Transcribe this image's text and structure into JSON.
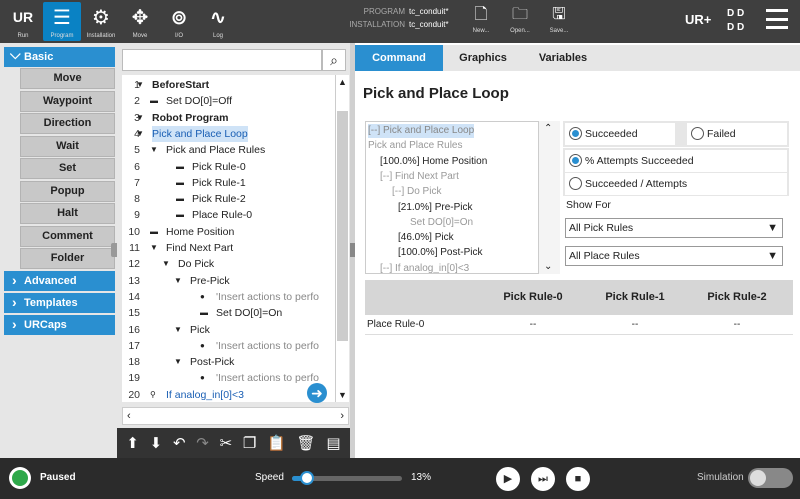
{
  "topnav": [
    {
      "label": "Run",
      "icon": "UR"
    },
    {
      "label": "Program",
      "icon": "☰"
    },
    {
      "label": "Installation",
      "icon": "⚙"
    },
    {
      "label": "Move",
      "icon": "✥"
    },
    {
      "label": "I/O",
      "icon": "⊚"
    },
    {
      "label": "Log",
      "icon": "∿"
    }
  ],
  "program": {
    "program_key": "PROGRAM",
    "program_value": "tc_conduit*",
    "installation_key": "INSTALLATION",
    "installation_value": "tc_conduit*"
  },
  "file": {
    "new": "New...",
    "open": "Open...",
    "save": "Save..."
  },
  "brand": {
    "ur_plus": "UR+",
    "dots": "D D\nD D"
  },
  "left": {
    "basic": "Basic",
    "basic_items": [
      "Move",
      "Waypoint",
      "Direction",
      "Wait",
      "Set",
      "Popup",
      "Halt",
      "Comment",
      "Folder"
    ],
    "advanced": "Advanced",
    "templates": "Templates",
    "urcaps": "URCaps"
  },
  "tree": [
    {
      "n": "1",
      "t": "BeforeStart",
      "bold": true
    },
    {
      "n": "2",
      "t": "Set DO[0]=Off"
    },
    {
      "n": "3",
      "t": "Robot Program",
      "bold": true
    },
    {
      "n": "4",
      "t": "Pick and Place Loop",
      "sel": true
    },
    {
      "n": "5",
      "t": "Pick and Place Rules"
    },
    {
      "n": "6",
      "t": "Pick Rule-0"
    },
    {
      "n": "7",
      "t": "Pick Rule-1"
    },
    {
      "n": "8",
      "t": "Pick Rule-2"
    },
    {
      "n": "9",
      "t": "Place Rule-0"
    },
    {
      "n": "10",
      "t": "Home Position"
    },
    {
      "n": "11",
      "t": "Find Next Part"
    },
    {
      "n": "12",
      "t": "Do Pick"
    },
    {
      "n": "13",
      "t": "Pre-Pick"
    },
    {
      "n": "14",
      "t": "'Insert actions to perfo"
    },
    {
      "n": "15",
      "t": "Set DO[0]=On"
    },
    {
      "n": "16",
      "t": "Pick"
    },
    {
      "n": "17",
      "t": "'Insert actions to perfo"
    },
    {
      "n": "18",
      "t": "Post-Pick"
    },
    {
      "n": "19",
      "t": "'Insert actions to perfo"
    },
    {
      "n": "20",
      "t": "If analog_in[0]<3"
    }
  ],
  "tabs": [
    "Command",
    "Graphics",
    "Variables"
  ],
  "right": {
    "title": "Pick and Place Loop",
    "mini": [
      "[--] Pick and Place Loop",
      "Pick and Place Rules",
      "[100.0%] Home Position",
      "[--] Find Next Part",
      "[--] Do Pick",
      "[21.0%] Pre-Pick",
      "Set DO[0]=On",
      "[46.0%] Pick",
      "[100.0%] Post-Pick",
      "[--] If analog_in[0]<3"
    ],
    "succeeded": "Succeeded",
    "failed": "Failed",
    "pct": "% Attempts Succeeded",
    "ratio": "Succeeded / Attempts",
    "show_for": "Show For",
    "pick_select": "All Pick Rules",
    "place_select": "All Place Rules",
    "cols": [
      "Pick Rule-0",
      "Pick Rule-1",
      "Pick Rule-2"
    ],
    "row_label": "Place Rule-0",
    "cells": [
      "--",
      "--",
      "--"
    ]
  },
  "footer": {
    "status": "Paused",
    "speed_label": "Speed",
    "speed_value": "13%",
    "simulation": "Simulation",
    "speed_fraction": 0.13
  }
}
